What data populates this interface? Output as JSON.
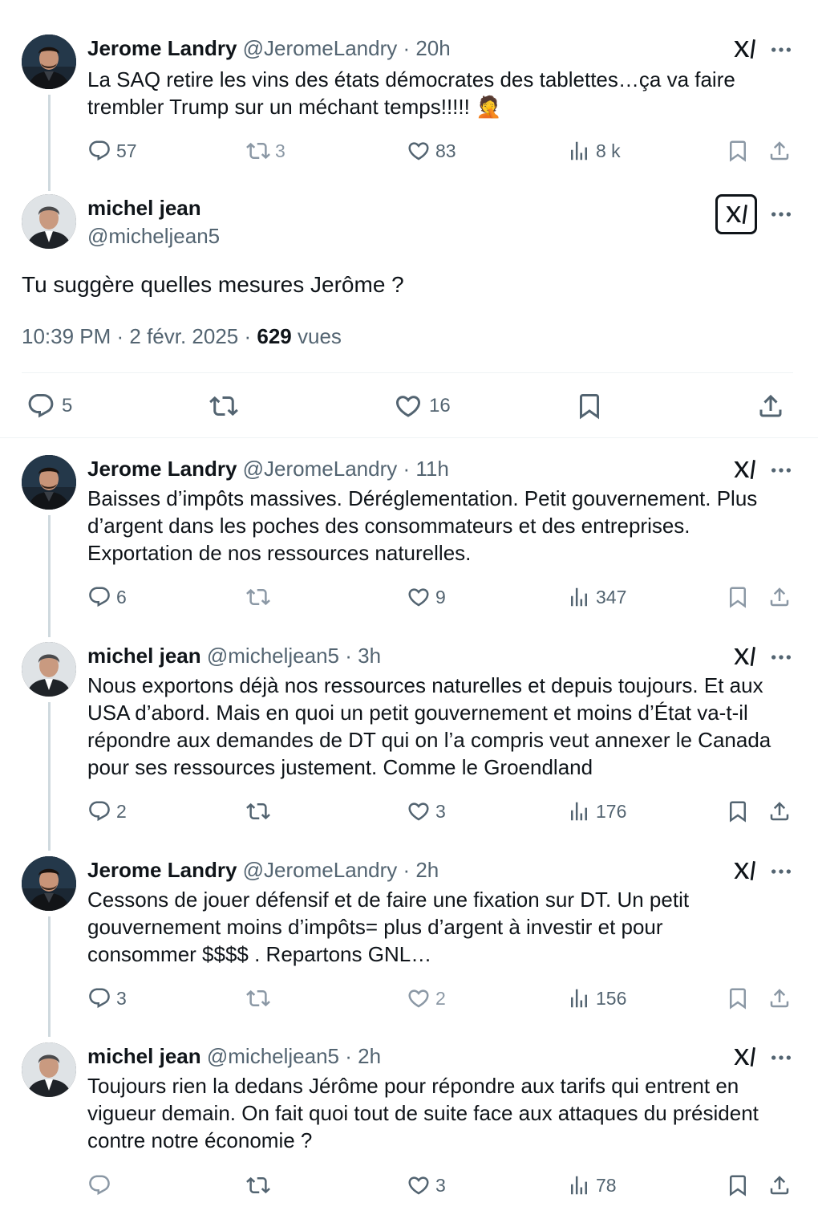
{
  "tweets": [
    {
      "name": "Jerome Landry",
      "handle": "@JeromeLandry",
      "time": "· 20h",
      "text_line1": "La SAQ retire les vins des états démocrates des tablettes…ça va faire",
      "text_line2": "trembler Trump sur un méchant temps!!!!! 🤦",
      "replies": "57",
      "reposts": "3",
      "likes": "83",
      "views": "8 k"
    },
    {
      "name": "Jerome Landry",
      "handle": "@JeromeLandry",
      "time": "· 11h",
      "lines": [
        "Baisses d’impôts massives. Déréglementation. Petit gouvernement. Plus",
        "d’argent dans les poches des consommateurs et des entreprises.",
        "Exportation de nos ressources naturelles."
      ],
      "replies": "6",
      "reposts": "",
      "likes": "9",
      "views": "347"
    },
    {
      "name": "michel jean",
      "handle": "@micheljean5",
      "time": "· 3h",
      "lines": [
        "Nous exportons déjà nos ressources naturelles et depuis toujours. Et aux",
        "USA d’abord. Mais en quoi un petit gouvernement et moins d’État va-t-il",
        "répondre aux demandes de DT qui on l’a compris veut annexer le Canada",
        "pour ses ressources justement. Comme le Groendland"
      ],
      "replies": "2",
      "reposts": "",
      "likes": "3",
      "views": "176"
    },
    {
      "name": "Jerome Landry",
      "handle": "@JeromeLandry",
      "time": "· 2h",
      "lines": [
        "Cessons de jouer défensif et de faire une fixation sur DT. Un petit",
        "gouvernement moins d’impôts= plus d’argent à investir et pour",
        "consommer $$$$ . Repartons GNL…"
      ],
      "replies": "3",
      "reposts": "",
      "likes": "2",
      "views": "156"
    },
    {
      "name": "michel jean",
      "handle": "@micheljean5",
      "time": "· 2h",
      "lines": [
        "Toujours rien la dedans Jérôme pour répondre aux tarifs qui entrent en",
        "vigueur demain. On fait quoi tout de suite face aux attaques du président",
        "contre notre économie ?"
      ],
      "replies": "",
      "reposts": "",
      "likes": "3",
      "views": "78"
    }
  ],
  "focal": {
    "name": "michel jean",
    "handle": "@micheljean5",
    "text": "Tu suggère quelles mesures Jerôme ?",
    "time": "10:39 PM · 2 févr. 2025 · ",
    "views_count": "629",
    "views_label": " vues",
    "replies": "5",
    "likes": "16"
  },
  "icons": [
    "reply-icon",
    "repost-icon",
    "like-icon",
    "views-icon",
    "bookmark-icon",
    "share-icon",
    "grok-icon",
    "more-icon"
  ],
  "colors": {
    "text": "#0f1419",
    "secondary": "#536471",
    "line": "#cfd9de"
  }
}
